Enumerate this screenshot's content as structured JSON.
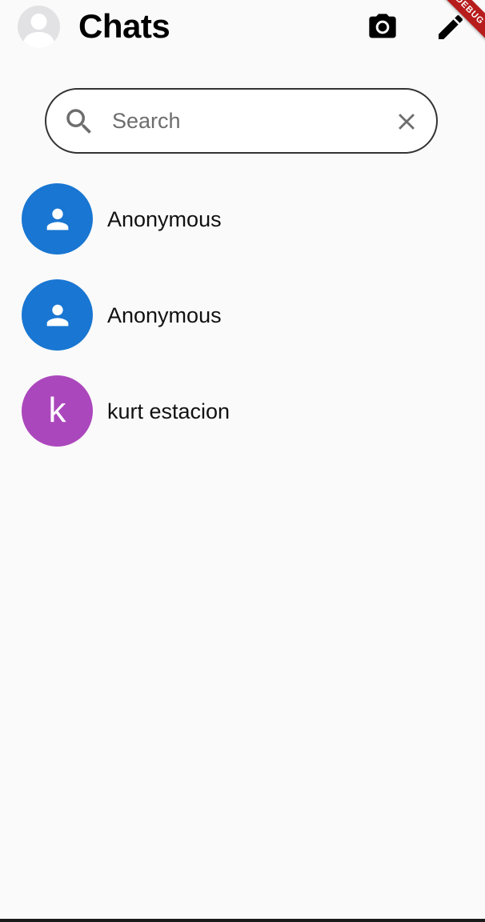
{
  "header": {
    "title": "Chats",
    "profile_icon": "person-silhouette-icon",
    "camera_icon": "camera-icon",
    "edit_icon": "pencil-icon",
    "debug_banner": "DEBUG"
  },
  "search": {
    "placeholder": "Search",
    "value": "",
    "search_icon": "search-icon",
    "clear_icon": "close-icon"
  },
  "chats": [
    {
      "name": "Anonymous",
      "avatar_type": "icon",
      "avatar_icon": "person-icon",
      "avatar_color": "#1976d2"
    },
    {
      "name": "Anonymous",
      "avatar_type": "icon",
      "avatar_icon": "person-icon",
      "avatar_color": "#1976d2"
    },
    {
      "name": "kurt estacion",
      "avatar_type": "letter",
      "avatar_letter": "k",
      "avatar_color": "#ab47bc"
    }
  ],
  "colors": {
    "background": "#fafafa",
    "blue_avatar": "#1976d2",
    "purple_avatar": "#ab47bc",
    "debug_banner": "#b71c1c"
  }
}
